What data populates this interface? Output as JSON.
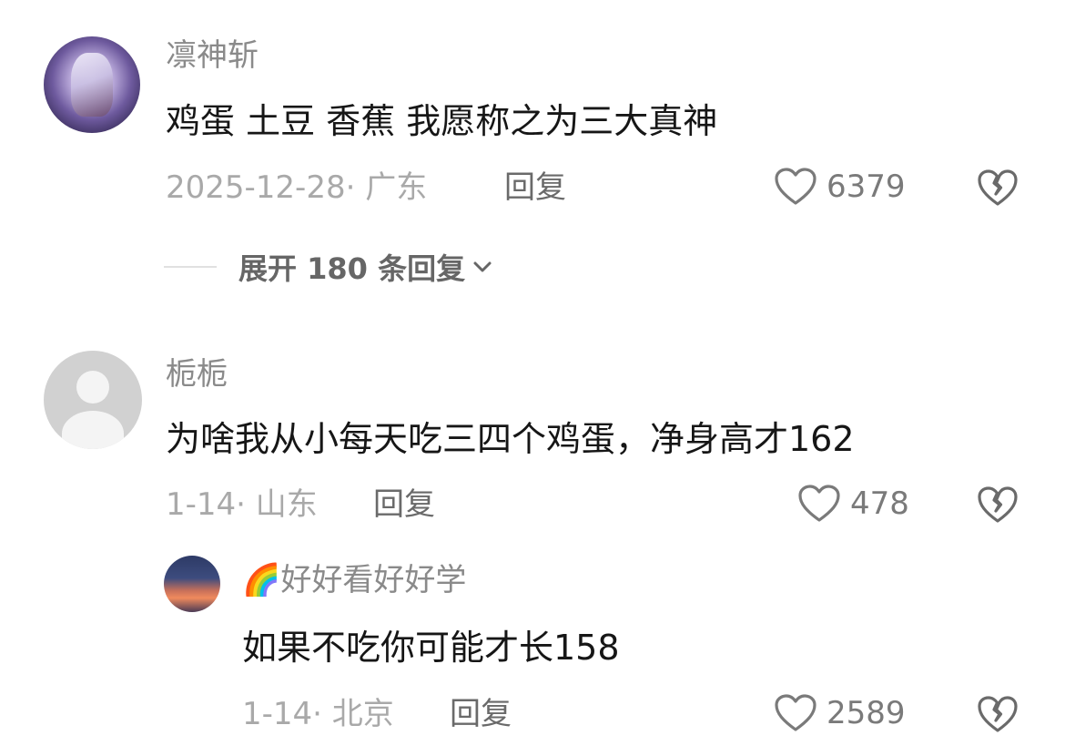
{
  "comments": [
    {
      "user": "凛神斩",
      "text": "鸡蛋 土豆 香蕉 我愿称之为三大真神",
      "date_location": "2025-12-28· 广东",
      "reply_label": "回复",
      "likes": "6379",
      "expand_label": "展开 180 条回复"
    },
    {
      "user": "栀栀",
      "text": "为啥我从小每天吃三四个鸡蛋，净身高才162",
      "date_location": "1-14· 山东",
      "reply_label": "回复",
      "likes": "478"
    }
  ],
  "reply": {
    "user_emoji": "🌈",
    "user": "好好看好好学",
    "text": "如果不吃你可能才长158",
    "date_location": "1-14· 北京",
    "reply_label": "回复",
    "likes": "2589"
  },
  "colors": {
    "heart": "#7a7a7a",
    "dislike": "#6a6a6a"
  },
  "icons": [
    "heart-icon",
    "broken-heart-icon",
    "chevron-down-icon"
  ]
}
